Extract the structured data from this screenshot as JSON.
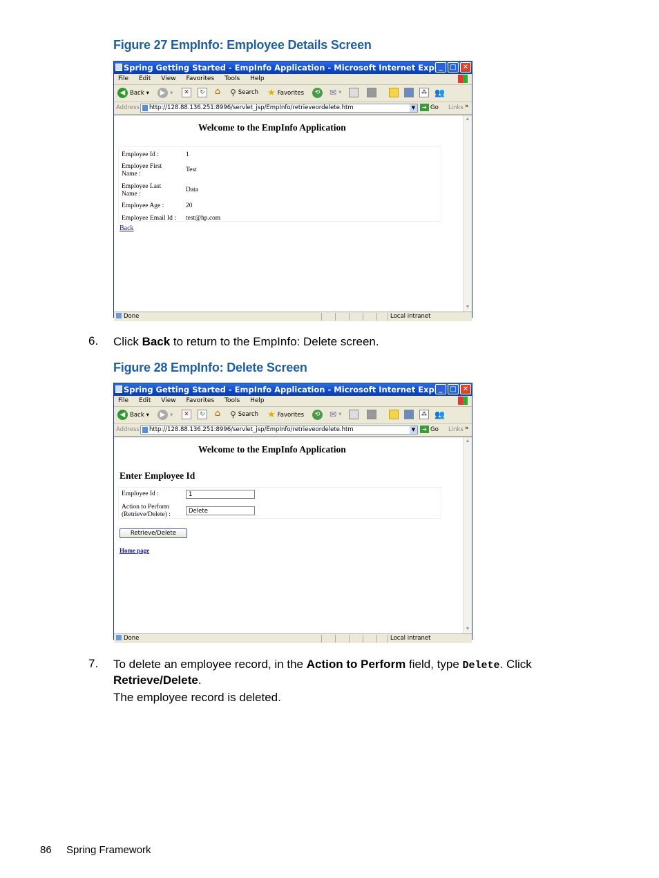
{
  "figure27": {
    "caption": "Figure 27 EmpInfo: Employee Details Screen",
    "window_title": "Spring Getting Started - EmpInfo Application - Microsoft Internet Expl...",
    "menu": [
      "File",
      "Edit",
      "View",
      "Favorites",
      "Tools",
      "Help"
    ],
    "toolbar": {
      "back": "Back",
      "search": "Search",
      "favorites": "Favorites"
    },
    "address_label": "Address",
    "address_url": "http://128.88.136.251:8996/servlet_jsp/EmpInfo/retrieveordelete.htm",
    "go_label": "Go",
    "links_label": "Links",
    "heading": "Welcome to the EmpInfo Application",
    "fields": [
      {
        "label": "Employee Id :",
        "value": "1"
      },
      {
        "label": "Employee First Name :",
        "value": "Test"
      },
      {
        "label": "Employee Last Name :",
        "value": "Data"
      },
      {
        "label": "Employee Age :",
        "value": "20"
      },
      {
        "label": "Employee Email Id :",
        "value": "test@hp.com"
      }
    ],
    "back_link": "Back",
    "status_done": "Done",
    "status_zone": "Local intranet"
  },
  "step6": {
    "number": "6.",
    "pre": "Click ",
    "bold": "Back",
    "post": " to return to the EmpInfo: Delete screen."
  },
  "figure28": {
    "caption": "Figure 28 EmpInfo: Delete Screen",
    "window_title": "Spring Getting Started - EmpInfo Application - Microsoft Internet Expl...",
    "menu": [
      "File",
      "Edit",
      "View",
      "Favorites",
      "Tools",
      "Help"
    ],
    "toolbar": {
      "back": "Back",
      "search": "Search",
      "favorites": "Favorites"
    },
    "address_label": "Address",
    "address_url": "http://128.88.136.251:8996/servlet_jsp/EmpInfo/retrieveordelete.htm",
    "go_label": "Go",
    "links_label": "Links",
    "heading": "Welcome to the EmpInfo Application",
    "subheading": "Enter Employee Id",
    "employee_id_label": "Employee Id :",
    "employee_id_value": "1",
    "action_label_1": "Action to Perform",
    "action_label_2": "(Retrieve/Delete) :",
    "action_value": "Delete",
    "submit_label": "Retrieve/Delete",
    "home_link": "Home page",
    "status_done": "Done",
    "status_zone": "Local intranet"
  },
  "step7": {
    "number": "7.",
    "t1": "To delete an employee record, in the ",
    "b1": "Action to Perform",
    "t2": " field, type ",
    "code": "Delete",
    "t3": ". Click",
    "b2": "Retrieve/Delete",
    "t4": ".",
    "result": "The employee record is deleted."
  },
  "footer": {
    "page": "86",
    "title": "Spring Framework"
  }
}
